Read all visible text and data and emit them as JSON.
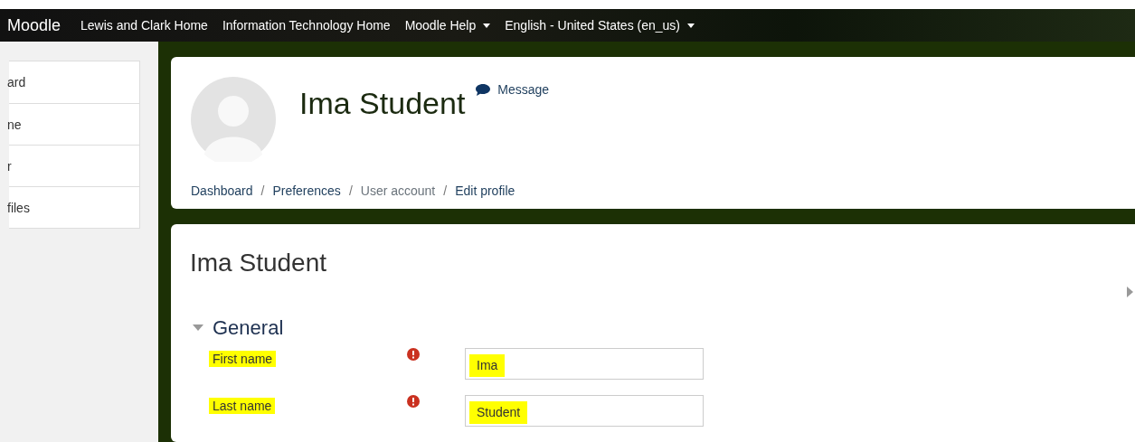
{
  "navbar": {
    "brand": "Moodle",
    "links": [
      {
        "label": "Lewis and Clark Home",
        "dropdown": false
      },
      {
        "label": "Information Technology Home",
        "dropdown": false
      },
      {
        "label": "Moodle Help",
        "dropdown": true
      },
      {
        "label": "English - United States (en_us)",
        "dropdown": true
      }
    ]
  },
  "sidebar": {
    "items": [
      "ard",
      "ne",
      "r",
      "files"
    ]
  },
  "profile": {
    "name": "Ima Student",
    "message": "Message",
    "breadcrumbs": [
      {
        "label": "Dashboard",
        "link": true
      },
      {
        "label": "Preferences",
        "link": true,
        "separator": "/"
      },
      {
        "label": "User account",
        "link": false,
        "separator": "/"
      },
      {
        "label": "Edit profile",
        "link": true,
        "separator": "/"
      }
    ]
  },
  "form": {
    "title": "Ima Student",
    "section": {
      "label": "General",
      "expanded": true
    },
    "fields": [
      {
        "label": "First name",
        "required": true,
        "value": "Ima",
        "highlighted": true
      },
      {
        "label": "Last name",
        "required": true,
        "value": "Student",
        "highlighted": true
      }
    ]
  }
}
